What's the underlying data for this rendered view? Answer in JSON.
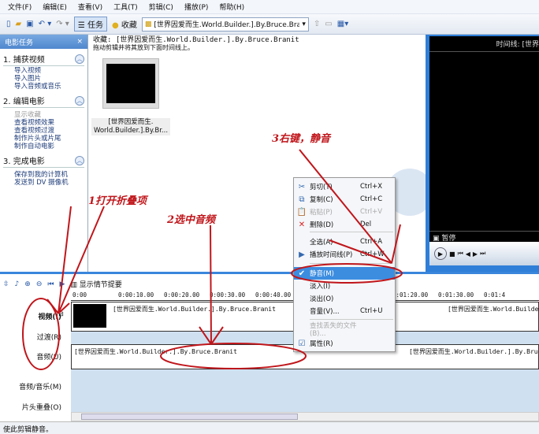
{
  "menu": [
    "文件(F)",
    "编辑(E)",
    "查看(V)",
    "工具(T)",
    "剪辑(C)",
    "播放(P)",
    "帮助(H)"
  ],
  "toolbar": {
    "tasks_label": "任务",
    "collections_label": "收藏",
    "collection_value": "[世界因爱而生.World.Builder.].By.Bruce.Bran"
  },
  "taskpane": {
    "title": "电影任务",
    "close": "×",
    "sections": [
      {
        "title": "1. 捕获视频",
        "items": [
          "导入视频",
          "导入图片",
          "导入音频或音乐"
        ]
      },
      {
        "title": "2. 编辑电影",
        "items": [
          "显示收藏",
          "查看视频效果",
          "查看视频过渡",
          "制作片头或片尾",
          "制作自动电影"
        ]
      },
      {
        "title": "3. 完成电影",
        "items": [
          "保存到我的计算机",
          "发送到 DV 摄像机"
        ]
      }
    ]
  },
  "collection": {
    "header": "收藏: [世界因爱而生.World.Builder.].By.Bruce.Branit",
    "hint": "拖动剪辑并将其放到下面时间线上。",
    "clip_label_1": "[世界因爱而生.",
    "clip_label_2": "World.Builder.].By.Br..."
  },
  "preview": {
    "title": "时间线: [世界",
    "status": "暂停"
  },
  "timeline": {
    "storyboard_label": "显示情节提要",
    "ruler": [
      "0:00",
      "0:00:10.00",
      "0:00:20.00",
      "0:00:30.00",
      "0:00:40.00",
      "0:",
      "01:10.00",
      "0:01:20.00",
      "0:01:30.00",
      "0:01:4"
    ],
    "tracks": {
      "video": "视频(I)",
      "transition": "过渡(R)",
      "audio": "音频(U)",
      "music": "音频/音乐(M)",
      "title": "片头重叠(O)"
    },
    "clip": "[世界因爱而生.World.Builder.].By.Bruce.Branit",
    "clip2": "[世界因爱而生.World.Builder",
    "audio_clip2": "[世界因爱而生.World.Builder.].By.Bruce"
  },
  "context_menu": [
    {
      "icon": "cut",
      "label": "剪切(T)",
      "shortcut": "Ctrl+X"
    },
    {
      "icon": "copy",
      "label": "复制(C)",
      "shortcut": "Ctrl+C"
    },
    {
      "icon": "paste",
      "label": "粘贴(P)",
      "shortcut": "Ctrl+V",
      "disabled": true
    },
    {
      "icon": "delete",
      "label": "删除(D)",
      "shortcut": "Del"
    },
    {
      "label": "全选(A)",
      "shortcut": "Ctrl+A"
    },
    {
      "icon": "play",
      "label": "播放时间线(P)",
      "shortcut": "Ctrl+W"
    },
    {
      "icon": "check",
      "label": "静音(M)",
      "shortcut": "",
      "checked": true
    },
    {
      "label": "淡入(I)",
      "shortcut": ""
    },
    {
      "label": "淡出(O)",
      "shortcut": ""
    },
    {
      "label": "音量(V)...",
      "shortcut": "Ctrl+U"
    },
    {
      "label": "查找丢失的文件(B)...",
      "shortcut": "",
      "disabled": true
    },
    {
      "icon": "properties",
      "label": "属性(R)",
      "shortcut": ""
    }
  ],
  "annotations": {
    "step1": "1打开折叠项",
    "step2": "2选中音频",
    "step3": "3右键，静音",
    "color": "#c0161b"
  },
  "status": "使此剪辑静音。"
}
